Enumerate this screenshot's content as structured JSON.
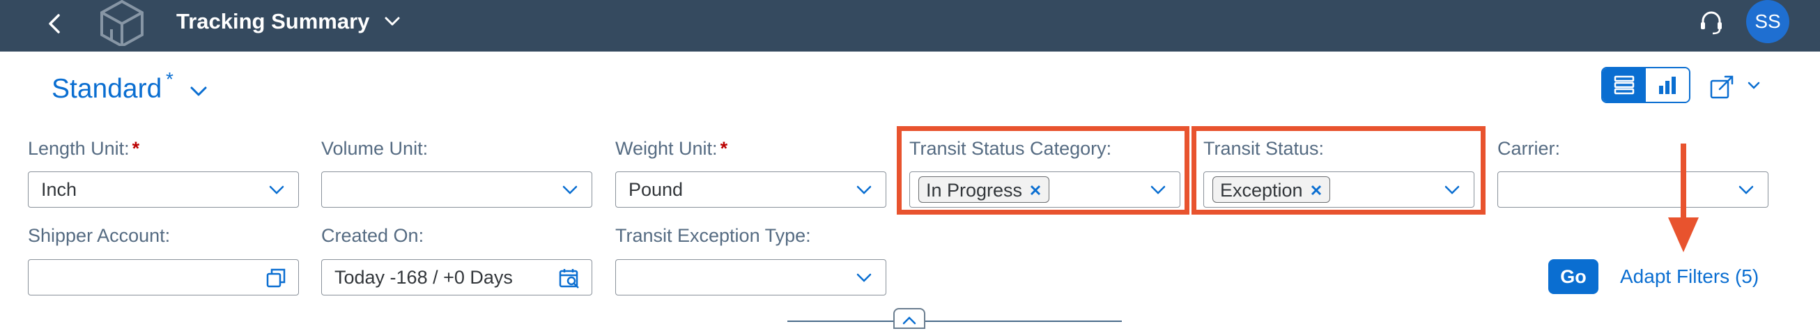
{
  "shell": {
    "title": "Tracking Summary",
    "avatar_initials": "SS",
    "back_icon": "chevron-left-icon",
    "help_icon": "headset-icon"
  },
  "variant": {
    "name": "Standard",
    "modified_marker": "*"
  },
  "toolbar": {
    "view_toggle": [
      "list-view-icon",
      "chart-view-icon"
    ],
    "share_icon": "share-icon"
  },
  "filters": {
    "length_unit": {
      "label": "Length Unit:",
      "required": "*",
      "value": "Inch"
    },
    "volume_unit": {
      "label": "Volume Unit:",
      "value": ""
    },
    "weight_unit": {
      "label": "Weight Unit:",
      "required": "*",
      "value": "Pound"
    },
    "transit_status_category": {
      "label": "Transit Status Category:",
      "token": "In Progress"
    },
    "transit_status": {
      "label": "Transit Status:",
      "token": "Exception"
    },
    "carrier": {
      "label": "Carrier:",
      "value": ""
    },
    "shipper_account": {
      "label": "Shipper Account:",
      "value": ""
    },
    "created_on": {
      "label": "Created On:",
      "value": "Today -168 / +0 Days"
    },
    "transit_exception_type": {
      "label": "Transit Exception Type:",
      "value": ""
    }
  },
  "actions": {
    "go_label": "Go",
    "adapt_filters_label": "Adapt Filters (5)"
  },
  "colors": {
    "shellbar": "#354a5f",
    "accent": "#0a6ed1",
    "highlight": "#e8532e",
    "required": "#bb0000"
  }
}
